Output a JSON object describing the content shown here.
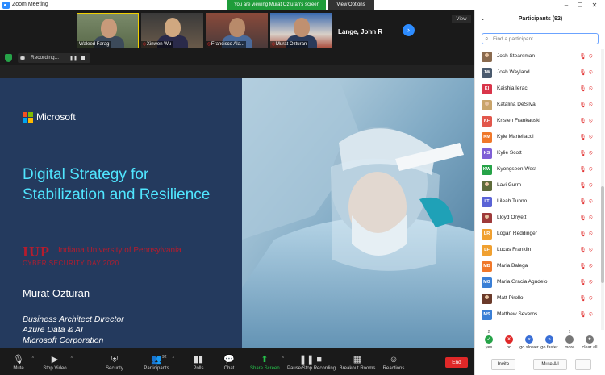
{
  "window": {
    "title": "Zoom Meeting",
    "viewing_banner": "You are viewing Murat Ozturan's screen",
    "view_options": "View Options",
    "controls": {
      "minimize": "–",
      "maximize": "☐",
      "close": "✕"
    }
  },
  "thumbnails": [
    {
      "name": "Waleed Farag",
      "muted": false
    },
    {
      "name": "Xinwen Wu",
      "muted": true
    },
    {
      "name": "Francisco Ala...",
      "muted": true
    },
    {
      "name": "Murat Ozturan",
      "muted": true
    }
  ],
  "text_tile": {
    "name": "Lange, John R"
  },
  "view_button": "View",
  "recording": {
    "label": "Recording..."
  },
  "slide": {
    "brand": "Microsoft",
    "title": "Digital Strategy for Stabilization and Resilience",
    "iup_mark": "IUP",
    "university": "Indiana University of Pennsylvania",
    "event": "CYBER SECURITY DAY 2020",
    "presenter": "Murat Ozturan",
    "roles": [
      "Business Architect Director",
      "Azure Data & AI",
      "Microsoft Corporation"
    ]
  },
  "toolbar": [
    {
      "id": "mute",
      "label": "Mute",
      "icon": "microphone-icon",
      "caret": true
    },
    {
      "id": "video",
      "label": "Stop Video",
      "icon": "camera-icon",
      "caret": true
    },
    {
      "id": "security",
      "label": "Security",
      "icon": "shield-icon"
    },
    {
      "id": "participants",
      "label": "Participants",
      "icon": "people-icon",
      "count": "92",
      "caret": true
    },
    {
      "id": "polls",
      "label": "Polls",
      "icon": "chart-icon"
    },
    {
      "id": "chat",
      "label": "Chat",
      "icon": "chat-icon"
    },
    {
      "id": "share",
      "label": "Share Screen",
      "icon": "share-arrow-icon",
      "caret": true
    },
    {
      "id": "record",
      "label": "Pause/Stop Recording",
      "icon": "pause-stop-icon"
    },
    {
      "id": "breakout",
      "label": "Breakout Rooms",
      "icon": "grid-icon"
    },
    {
      "id": "reactions",
      "label": "Reactions",
      "icon": "smiley-icon"
    }
  ],
  "end_button": "End",
  "participants_panel": {
    "title": "Participants (92)",
    "search_placeholder": "Find a participant",
    "items": [
      {
        "name": "Josh Stearsman",
        "initials": "",
        "color": "#8a6a4e",
        "photo": true
      },
      {
        "name": "Josh Wayland",
        "initials": "JW",
        "color": "#4a5a6e"
      },
      {
        "name": "Kaishia Ieraci",
        "initials": "KI",
        "color": "#d9354a"
      },
      {
        "name": "Katalina DeSilva",
        "initials": "",
        "color": "#c9a46a",
        "photo": true
      },
      {
        "name": "Kristen Frankauski",
        "initials": "KF",
        "color": "#e2574c"
      },
      {
        "name": "Kyle Martellacci",
        "initials": "KM",
        "color": "#f0782a"
      },
      {
        "name": "Kylie Scott",
        "initials": "KS",
        "color": "#7f5fd6"
      },
      {
        "name": "Kyongseon West",
        "initials": "KW",
        "color": "#26a348"
      },
      {
        "name": "Lavi Gurm",
        "initials": "",
        "color": "#5e6b3a",
        "photo": true
      },
      {
        "name": "Lileah Tunno",
        "initials": "LT",
        "color": "#5a63d6"
      },
      {
        "name": "Lloyd Onyett",
        "initials": "",
        "color": "#9e3a3a",
        "photo": true
      },
      {
        "name": "Logan Reddinger",
        "initials": "LR",
        "color": "#f0a030"
      },
      {
        "name": "Lucas Franklin",
        "initials": "LF",
        "color": "#f0a030"
      },
      {
        "name": "Maria Balega",
        "initials": "MB",
        "color": "#f0782a"
      },
      {
        "name": "Maria Gracia Agudelo",
        "initials": "MG",
        "color": "#3a7fd6"
      },
      {
        "name": "Matt Pirollo",
        "initials": "",
        "color": "#6a3a2a",
        "photo": true
      },
      {
        "name": "Matthew Severns",
        "initials": "MS",
        "color": "#3a7fd6"
      }
    ],
    "feedback": [
      {
        "label": "yes",
        "count": "2",
        "color": "#26a348",
        "glyph": "✓"
      },
      {
        "label": "no",
        "count": "",
        "color": "#e02828",
        "glyph": "✕"
      },
      {
        "label": "go slower",
        "count": "",
        "color": "#3a6fd6",
        "glyph": "«"
      },
      {
        "label": "go faster",
        "count": "",
        "color": "#3a6fd6",
        "glyph": "»"
      },
      {
        "label": "more",
        "count": "1",
        "color": "#777777",
        "glyph": "…"
      },
      {
        "label": "clear all",
        "count": "",
        "color": "#777777",
        "glyph": "✦"
      }
    ],
    "buttons": {
      "invite": "Invite",
      "mute_all": "Mute All",
      "more": "..."
    }
  }
}
